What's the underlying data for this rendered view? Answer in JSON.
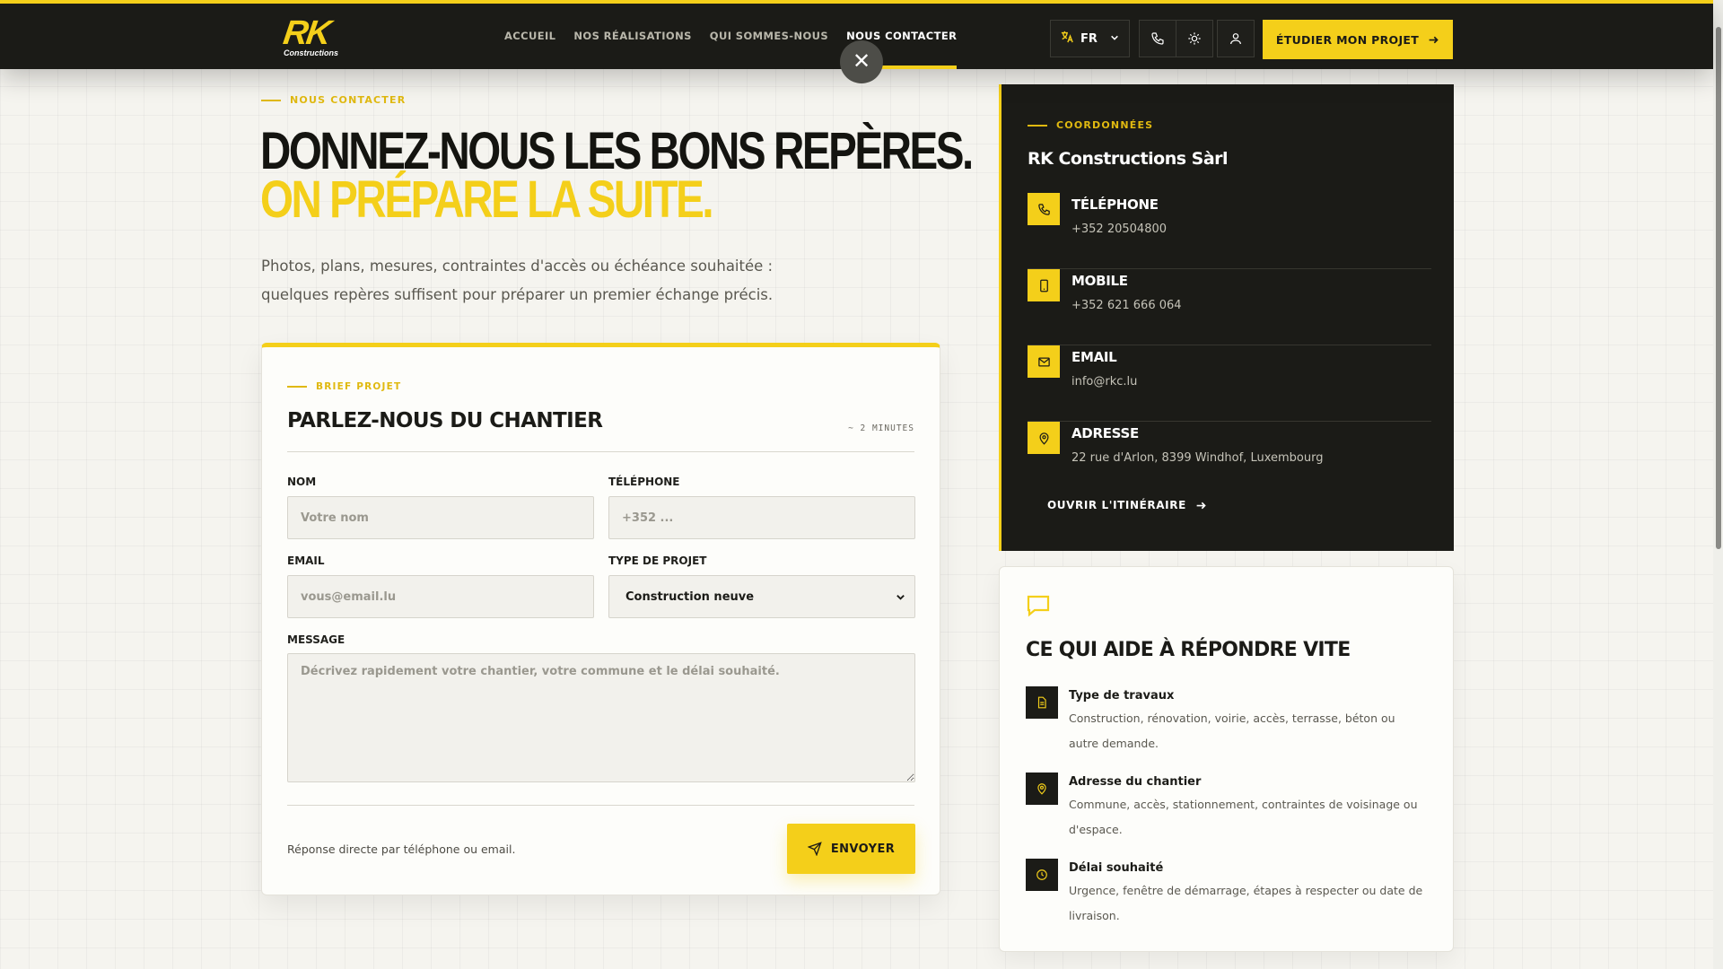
{
  "header": {
    "logo_mark": "RK",
    "logo_sub": "Constructions",
    "nav": [
      "ACCUEIL",
      "NOS RÉALISATIONS",
      "QUI SOMMES-NOUS",
      "NOUS CONTACTER"
    ],
    "active_nav": "NOUS CONTACTER",
    "close_glyph": "✕",
    "lang": "FR",
    "cta": "ÉTUDIER MON PROJET",
    "icons": [
      "translate-icon",
      "chevron-down-icon",
      "phone-icon",
      "sun-icon",
      "user-icon",
      "arrow-right-icon",
      "close-icon"
    ]
  },
  "intro": {
    "eyebrow": "NOUS CONTACTER",
    "headline_line1": "DONNEZ-NOUS LES BONS REPÈRES.",
    "headline_line2": "ON PRÉPARE LA SUITE.",
    "lead": "Photos, plans, mesures, contraintes d'accès ou échéance souhaitée : quelques repères suffisent pour préparer un premier échange précis."
  },
  "form": {
    "eyebrow": "BRIEF PROJET",
    "title": "PARLEZ-NOUS DU CHANTIER",
    "time": "~ 2 MINUTES",
    "fields": {
      "name_label": "NOM",
      "name_placeholder": "Votre nom",
      "phone_label": "TÉLÉPHONE",
      "phone_placeholder": "+352 ...",
      "email_label": "EMAIL",
      "email_placeholder": "vous@email.lu",
      "type_label": "TYPE DE PROJET",
      "type_value": "Construction neuve",
      "message_label": "MESSAGE",
      "message_placeholder": "Décrivez rapidement votre chantier, votre commune et le délai souhaité."
    },
    "note": "Réponse directe par téléphone ou email.",
    "submit": "ENVOYER"
  },
  "contact": {
    "eyebrow": "COORDONNÉES",
    "company": "RK Constructions Sàrl",
    "items": [
      {
        "label": "TÉLÉPHONE",
        "value": "+352 20504800",
        "icon": "phone-icon"
      },
      {
        "label": "MOBILE",
        "value": "+352 621 666 064",
        "icon": "mobile-icon"
      },
      {
        "label": "EMAIL",
        "value": "info@rkc.lu",
        "icon": "mail-icon"
      },
      {
        "label": "ADRESSE",
        "value": "22 rue d'Arlon, 8399 Windhof, Luxembourg",
        "icon": "map-pin-icon"
      }
    ],
    "itinerary": "OUVRIR L'ITINÉRAIRE"
  },
  "help": {
    "icon": "chat-bubble-icon",
    "title": "CE QUI AIDE À RÉPONDRE VITE",
    "items": [
      {
        "title": "Type de travaux",
        "text": "Construction, rénovation, voirie, accès, terrasse, béton ou autre demande.",
        "icon": "document-icon"
      },
      {
        "title": "Adresse du chantier",
        "text": "Commune, accès, stationnement, contraintes de voisinage ou d'espace.",
        "icon": "map-pin-icon"
      },
      {
        "title": "Délai souhaité",
        "text": "Urgence, fenêtre de démarrage, étapes à respecter ou date de livraison.",
        "icon": "clock-icon"
      }
    ]
  },
  "colors": {
    "accent": "#f4cf1a",
    "dark": "#1b1b17",
    "background": "#f5f4ef"
  }
}
